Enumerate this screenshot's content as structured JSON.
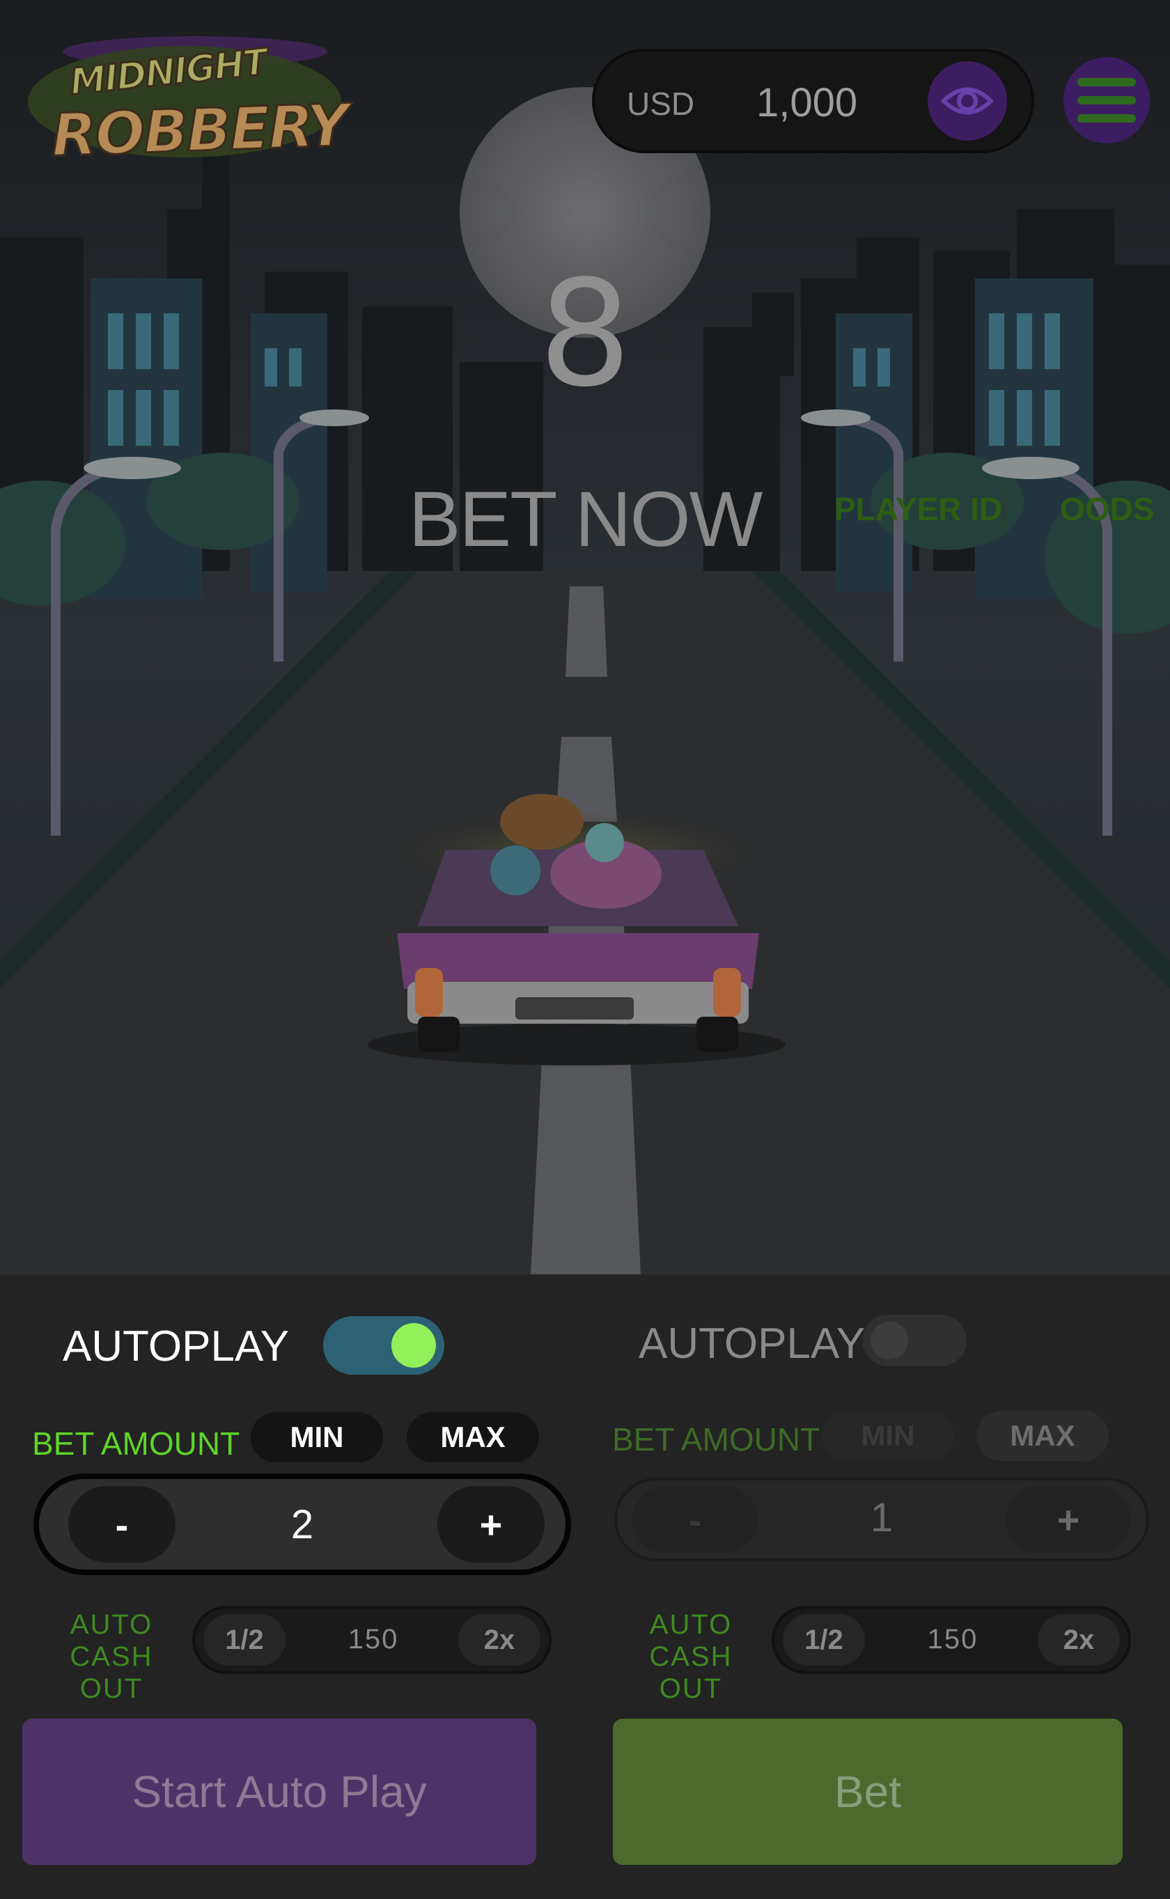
{
  "game": {
    "logo_line1": "MIDNIGHT",
    "logo_line2": "ROBBERY"
  },
  "header": {
    "currency": "USD",
    "balance": "1,000",
    "eye_icon": "eye-icon",
    "menu_icon": "hamburger-menu-icon"
  },
  "round": {
    "countdown": "8",
    "status": "BET NOW",
    "player_id_label": "PLAYER ID",
    "odds_label": "OODS"
  },
  "bet_panel_1": {
    "autoplay_label": "AUTOPLAY",
    "autoplay_on": true,
    "bet_amount_label": "BET AMOUNT",
    "min_label": "MIN",
    "max_label": "MAX",
    "minus_label": "-",
    "plus_label": "+",
    "bet_value": "2",
    "auto_cash_out_line1": "AUTO",
    "auto_cash_out_line2": "CASH OUT",
    "half_label": "1/2",
    "cash_out_value": "150",
    "double_label": "2x",
    "action_label": "Start Auto Play"
  },
  "bet_panel_2": {
    "autoplay_label": "AUTOPLAY",
    "autoplay_on": false,
    "bet_amount_label": "BET AMOUNT",
    "min_label": "MIN",
    "max_label": "MAX",
    "minus_label": "-",
    "plus_label": "+",
    "bet_value": "1",
    "auto_cash_out_line1": "AUTO",
    "auto_cash_out_line2": "CASH OUT",
    "half_label": "1/2",
    "cash_out_value": "150",
    "double_label": "2x",
    "action_label": "Bet"
  },
  "colors": {
    "accent_green": "#92f05a",
    "accent_purple": "#4d3268",
    "bet_green": "#4c6a2e",
    "toggle_on": "#2d6275"
  }
}
